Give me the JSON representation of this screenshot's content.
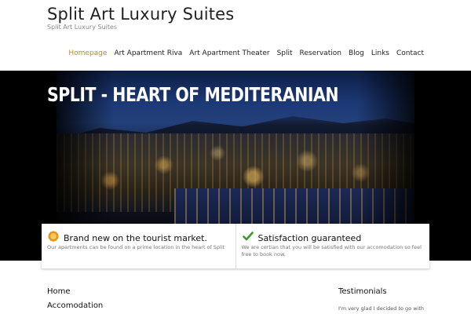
{
  "header": {
    "title": "Split Art Luxury Suites",
    "description": "Split Art Luxury Suites"
  },
  "nav": {
    "items": [
      {
        "label": "Homepage",
        "active": true
      },
      {
        "label": "Art Apartment Riva",
        "active": false
      },
      {
        "label": "Art Apartment Theater",
        "active": false
      },
      {
        "label": "Split",
        "active": false
      },
      {
        "label": "Reservation",
        "active": false
      },
      {
        "label": "Blog",
        "active": false
      },
      {
        "label": "Links",
        "active": false
      },
      {
        "label": "Contact",
        "active": false
      }
    ],
    "active_color": "#c98a1a"
  },
  "hero": {
    "title": "SPLIT - HEART OF MEDITERANIAN"
  },
  "features": [
    {
      "icon": "sun-badge-icon",
      "title": "Brand new on the tourist market.",
      "text": "Our apartments can be found on a prime location in the heart of Split"
    },
    {
      "icon": "checkmark-icon",
      "title": "Satisfaction guaranteed",
      "text": "We are certian that you will be satisfied with our accomodation so feel free to book now."
    }
  ],
  "content_menu": {
    "items": [
      "Home",
      "Accomodation"
    ]
  },
  "sidebar": {
    "title": "Testimonials",
    "text": "I'm very glad I decided to go with"
  }
}
